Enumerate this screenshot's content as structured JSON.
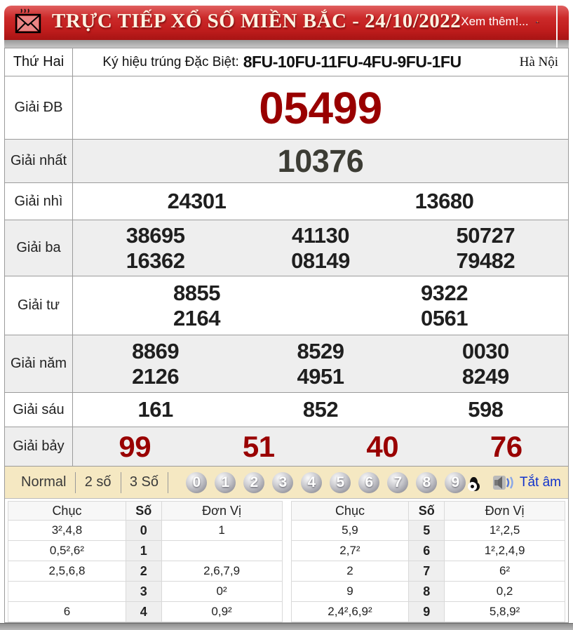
{
  "header": {
    "title": "TRỰC TIẾP XỔ SỐ MIỀN BẮC - 24/10/2022",
    "more_link": "Xem thêm!..."
  },
  "info_row": {
    "day": "Thứ Hai",
    "symbol_label": "Ký hiệu trúng Đặc Biệt:",
    "symbol_value": "8FU-10FU-11FU-4FU-9FU-1FU",
    "region": "Hà Nội"
  },
  "prizes": [
    {
      "label": "Giải ĐB",
      "rows": [
        [
          "05499"
        ]
      ]
    },
    {
      "label": "Giải nhất",
      "rows": [
        [
          "10376"
        ]
      ]
    },
    {
      "label": "Giải nhì",
      "rows": [
        [
          "24301",
          "13680"
        ]
      ]
    },
    {
      "label": "Giải ba",
      "rows": [
        [
          "38695",
          "41130",
          "50727"
        ],
        [
          "16362",
          "08149",
          "79482"
        ]
      ]
    },
    {
      "label": "Giải tư",
      "rows": [
        [
          "8855",
          "9322"
        ],
        [
          "2164",
          "0561"
        ]
      ]
    },
    {
      "label": "Giải năm",
      "rows": [
        [
          "8869",
          "8529",
          "0030"
        ],
        [
          "2126",
          "4951",
          "8249"
        ]
      ]
    },
    {
      "label": "Giải sáu",
      "rows": [
        [
          "161",
          "852",
          "598"
        ]
      ]
    },
    {
      "label": "Giải bảy",
      "rows": [
        [
          "99",
          "51",
          "40",
          "76"
        ]
      ]
    }
  ],
  "toolbar": {
    "modes": [
      "Normal",
      "2 số",
      "3 Số"
    ],
    "digits": [
      "0",
      "1",
      "2",
      "3",
      "4",
      "5",
      "6",
      "7",
      "8",
      "9"
    ],
    "mute_label": "Tắt âm"
  },
  "stats_tables": [
    {
      "headers": {
        "chuc": "Chục",
        "so": "Số",
        "donvi": "Đơn Vị"
      },
      "rows": [
        {
          "chuc": "3²,4,8",
          "so": "0",
          "donvi": "1"
        },
        {
          "chuc": "0,5²,6²",
          "so": "1",
          "donvi": ""
        },
        {
          "chuc": "2,5,6,8",
          "so": "2",
          "donvi": "2,6,7,9"
        },
        {
          "chuc": "",
          "so": "3",
          "donvi": "0²"
        },
        {
          "chuc": "6",
          "so": "4",
          "donvi": "0,9²"
        }
      ]
    },
    {
      "headers": {
        "chuc": "Chục",
        "so": "Số",
        "donvi": "Đơn Vị"
      },
      "rows": [
        {
          "chuc": "5,9",
          "so": "5",
          "donvi": "1²,2,5"
        },
        {
          "chuc": "2,7²",
          "so": "6",
          "donvi": "1²,2,4,9"
        },
        {
          "chuc": "2",
          "so": "7",
          "donvi": "6²"
        },
        {
          "chuc": "9",
          "so": "8",
          "donvi": "0,2"
        },
        {
          "chuc": "2,4²,6,9²",
          "so": "9",
          "donvi": "5,8,9²"
        }
      ]
    }
  ],
  "colors": {
    "header_red": "#c01d1d",
    "special_number_red": "#990000",
    "toolbar_beige": "#f5e8c2",
    "mute_link_blue": "#1133cc"
  }
}
